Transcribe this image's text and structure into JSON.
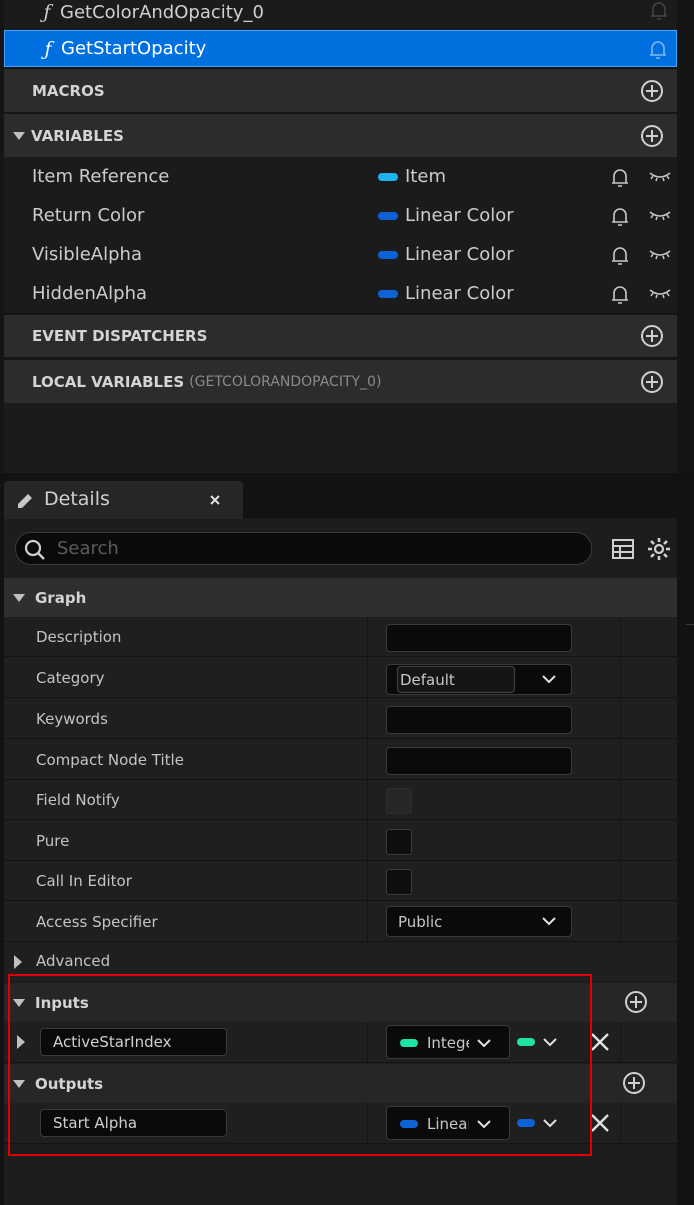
{
  "functions": [
    {
      "glyph": "ƒ",
      "label": "GetColorAndOpacity_0",
      "selected": false
    },
    {
      "glyph": "ƒ",
      "label": "GetStartOpacity",
      "selected": true
    }
  ],
  "sections": {
    "macros": "MACROS",
    "variables": "VARIABLES",
    "event_dispatchers": "EVENT DISPATCHERS",
    "local_variables": "LOCAL VARIABLES",
    "local_variables_scope": "(GETCOLORANDOPACITY_0)"
  },
  "variables": [
    {
      "name": "Item Reference",
      "type": "Item",
      "color": "#1fb2ee"
    },
    {
      "name": "Return Color",
      "type": "Linear Color",
      "color": "#0d63d6"
    },
    {
      "name": "VisibleAlpha",
      "type": "Linear Color",
      "color": "#0d63d6"
    },
    {
      "name": "HiddenAlpha",
      "type": "Linear Color",
      "color": "#0d63d6"
    }
  ],
  "details": {
    "tab_title": "Details",
    "search_placeholder": "Search",
    "graph_section": "Graph",
    "properties": {
      "description": "Description",
      "category": "Category",
      "category_value": "Default",
      "keywords": "Keywords",
      "compact_node_title": "Compact Node Title",
      "field_notify": "Field Notify",
      "pure": "Pure",
      "call_in_editor": "Call In Editor",
      "access_specifier": "Access Specifier",
      "access_specifier_value": "Public"
    },
    "advanced": "Advanced",
    "inputs_label": "Inputs",
    "inputs": [
      {
        "name": "ActiveStarIndex",
        "type": "Integer",
        "color": "#1ee3a5"
      }
    ],
    "outputs_label": "Outputs",
    "outputs": [
      {
        "name": "Start Alpha",
        "type": "Linear Color",
        "color": "#0d63d6"
      }
    ]
  },
  "colors": {
    "selection": "#0070e0",
    "highlight_box": "#e00000",
    "integer_pin": "#1ee3a5",
    "linear_color_pin": "#0d63d6",
    "object_pin": "#1fb2ee"
  }
}
